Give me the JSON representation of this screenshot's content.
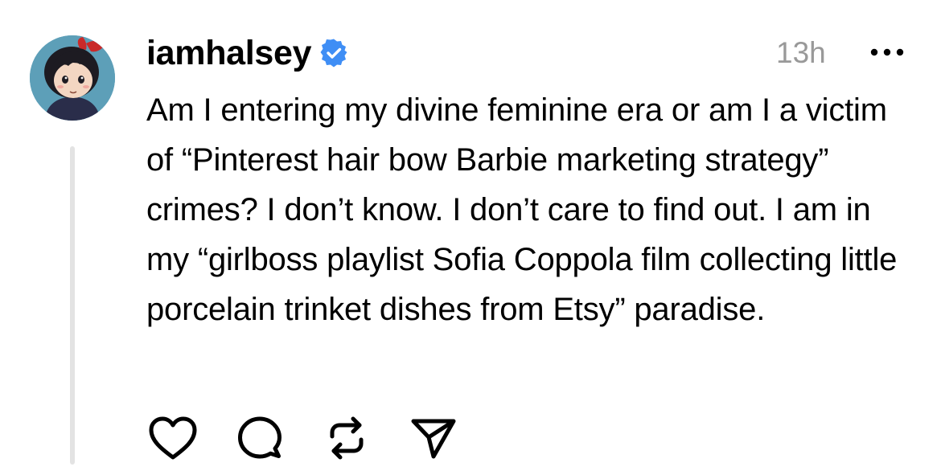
{
  "post": {
    "username": "iamhalsey",
    "verified": true,
    "timestamp": "13h",
    "text": "Am I entering my divine feminine era or am I a victim of “Pinterest hair bow Barbie marketing strategy” crimes? I don’t know. I don’t care to find out. I am in my “girlboss playlist Sofia Coppola film collecting little porcelain trinket dishes from Etsy” paradise."
  },
  "icons": {
    "avatar": "cartoon-girl-avatar",
    "verified": "verified-badge-icon",
    "more": "more-options-icon",
    "actions": [
      "heart-icon",
      "comment-icon",
      "repost-icon",
      "share-icon"
    ]
  },
  "colors": {
    "text": "#000000",
    "timestamp": "#999999",
    "verified_badge": "#3f8ef5",
    "thread_line": "#e3e3e3",
    "background": "#ffffff"
  }
}
